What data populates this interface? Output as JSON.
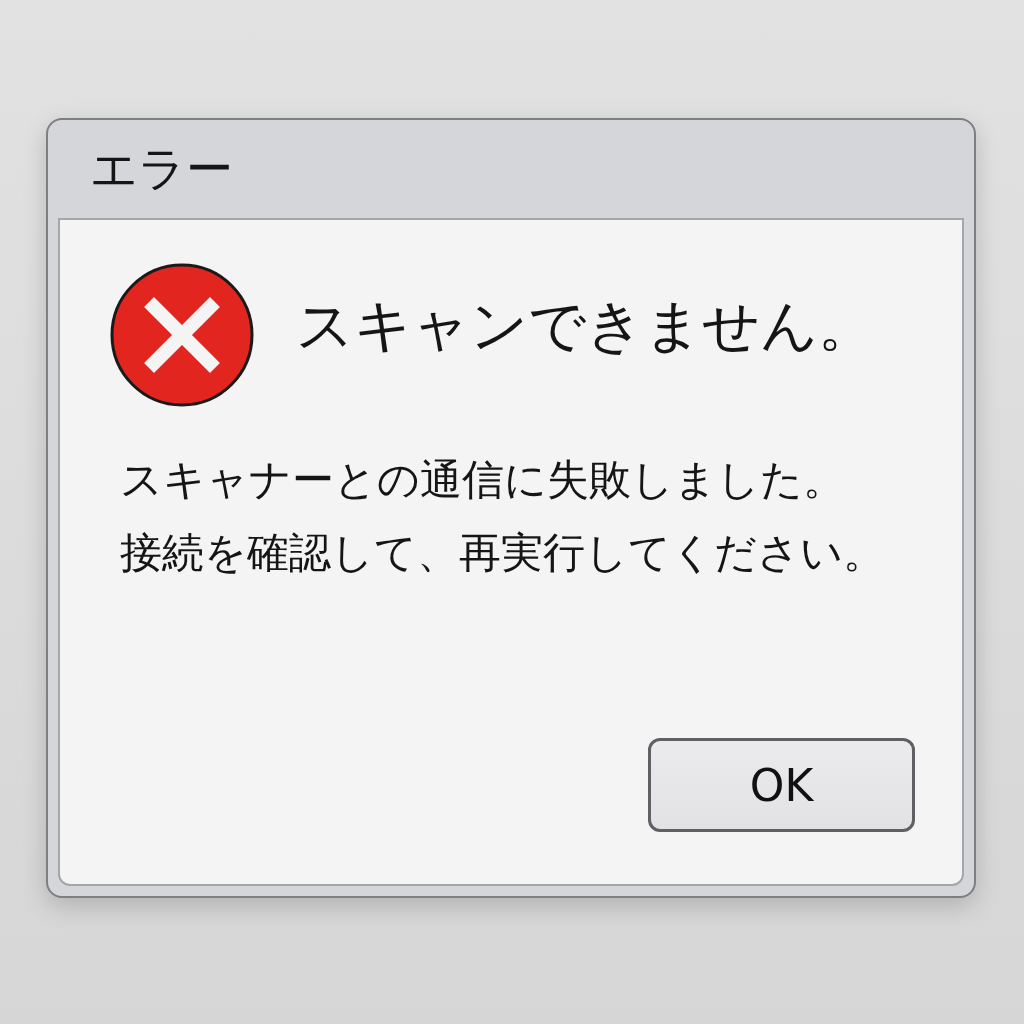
{
  "window": {
    "title": "エラー"
  },
  "dialog": {
    "heading": "スキャンできません。",
    "message_lines": [
      "スキャナーとの通信に失敗しました。",
      "接続を確認して、再実行してください。"
    ]
  },
  "buttons": [
    {
      "label": "OK"
    }
  ]
}
